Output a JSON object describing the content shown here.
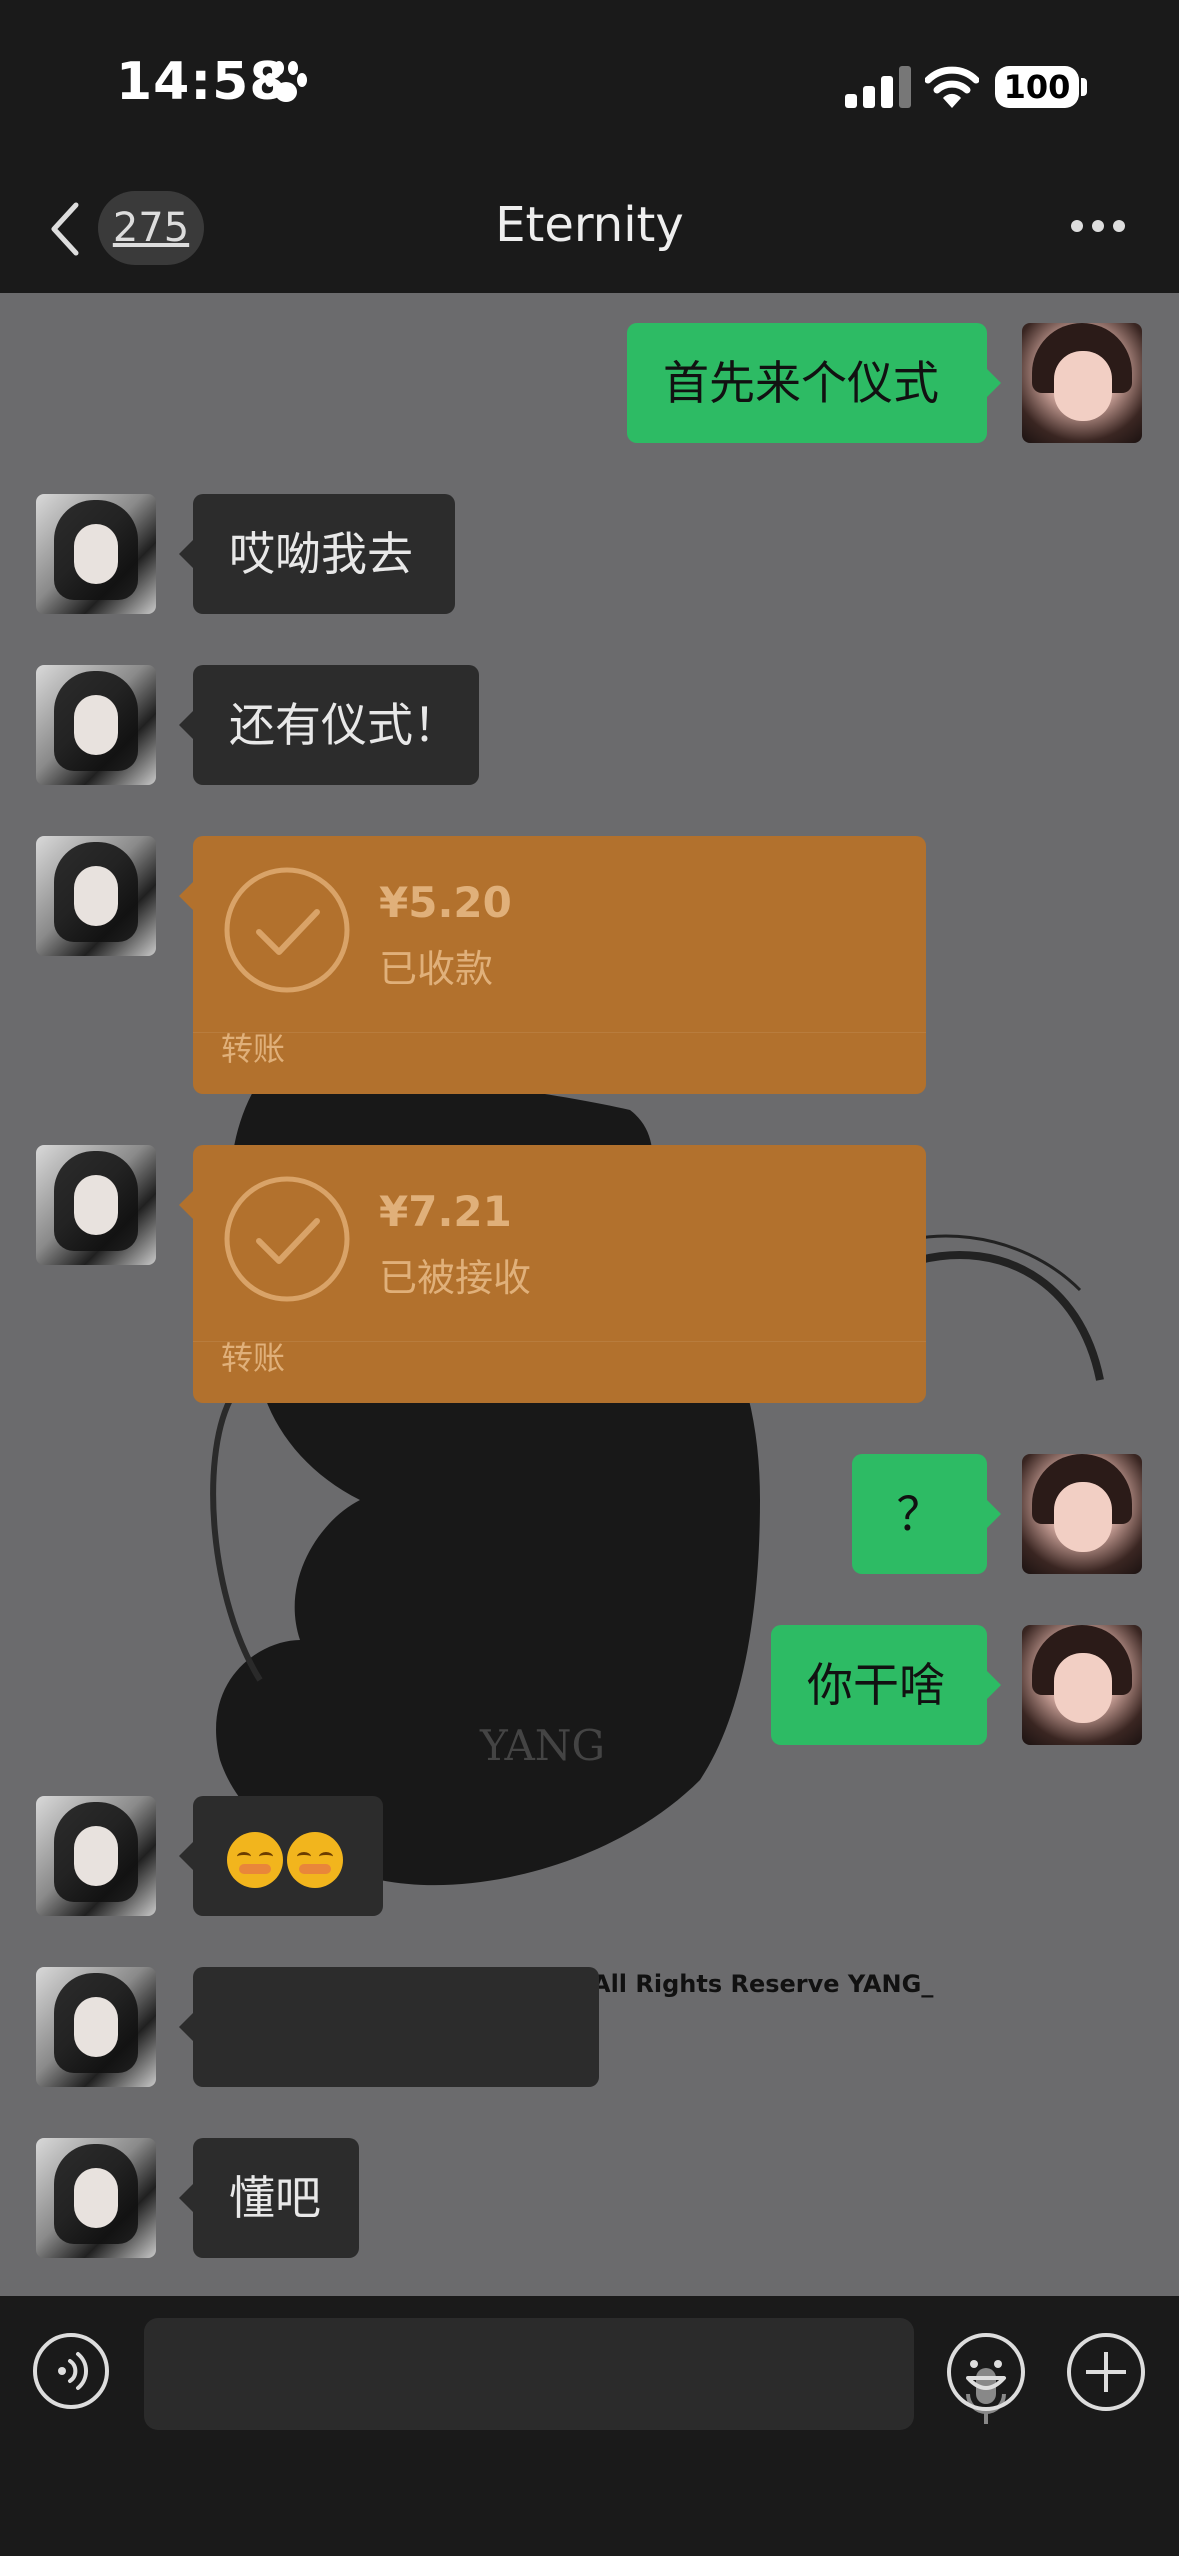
{
  "status_bar": {
    "time": "14:58",
    "battery": "100",
    "icons": [
      "paw-icon",
      "signal-icon",
      "wifi-icon",
      "battery-icon"
    ]
  },
  "nav": {
    "unread_count": "275",
    "title": "Eternity",
    "icons": [
      "back-chevron-icon",
      "more-icon"
    ]
  },
  "messages": [
    {
      "side": "right",
      "type": "text",
      "text": "首先来个仪式"
    },
    {
      "side": "left",
      "type": "text",
      "text": "哎呦我去"
    },
    {
      "side": "left",
      "type": "text",
      "text": "还有仪式！"
    },
    {
      "side": "left",
      "type": "transfer",
      "amount": "¥5.20",
      "status": "已收款",
      "label": "转账"
    },
    {
      "side": "left",
      "type": "transfer",
      "amount": "¥7.21",
      "status": "已被接收",
      "label": "转账"
    },
    {
      "side": "right",
      "type": "text",
      "text": "？"
    },
    {
      "side": "right",
      "type": "text",
      "text": "你干啥"
    },
    {
      "side": "left",
      "type": "emoji",
      "emoji_count": 2
    },
    {
      "side": "left",
      "type": "text",
      "text": ""
    },
    {
      "side": "left",
      "type": "text",
      "text": "懂吧"
    }
  ],
  "background": {
    "watermark": "All Rights Reserve YANG_"
  },
  "input_bar": {
    "icons": [
      "voice-icon",
      "microphone-icon",
      "emoji-icon",
      "plus-icon"
    ]
  },
  "colors": {
    "bubble_right": "#2dbb64",
    "bubble_left": "#2c2c2c",
    "transfer": "#b2712d",
    "chat_background": "#6b6b6d"
  }
}
